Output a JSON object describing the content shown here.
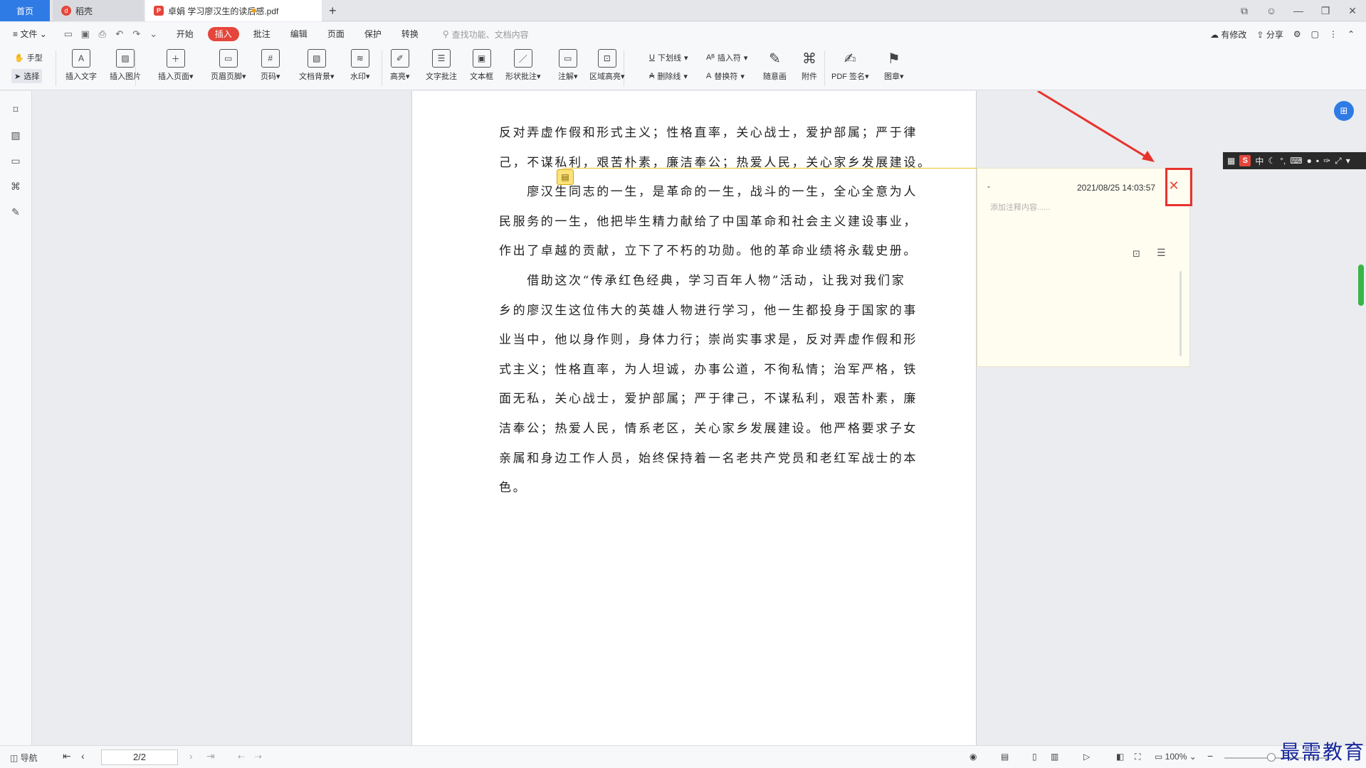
{
  "tabs": {
    "home": "首页",
    "daoke": "稻壳",
    "doc": "卓娟 学习廖汉生的读后感.pdf",
    "new": "+"
  },
  "menu": {
    "file": "文件",
    "items": [
      "开始",
      "插入",
      "批注",
      "编辑",
      "页面",
      "保护",
      "转换"
    ],
    "active_index": 1,
    "search_placeholder": "查找功能、文档内容",
    "modify": "有修改",
    "share": "分享"
  },
  "ribbon": {
    "hand": "手型",
    "select": "选择",
    "tools": [
      "插入文字",
      "插入图片",
      "插入页面",
      "页眉页脚",
      "页码",
      "文档背景",
      "水印",
      "高亮",
      "文字批注",
      "文本框",
      "形状批注",
      "注解",
      "区域高亮"
    ],
    "underline": "下划线",
    "strikethrough": "删除线",
    "insert_symbol": "插入符",
    "replace_symbol": "替换符",
    "freehand": "随意画",
    "attachment": "附件",
    "pdf_sign": "PDF 签名",
    "stamp": "图章"
  },
  "document": {
    "lines": [
      "反对弄虚作假和形式主义；性格直率，关心战士，爱护部属；严于律",
      "己，不谋私利，艰苦朴素，廉洁奉公；热爱人民，关心家乡发展建设。",
      "　　廖汉生同志的一生，是革命的一生，战斗的一生，全心全意为人",
      "民服务的一生，他把毕生精力献给了中国革命和社会主义建设事业，",
      "作出了卓越的贡献，立下了不朽的功勋。他的革命业绩将永载史册。",
      "　　借助这次“传承红色经典，学习百年人物”活动，让我对我们家",
      "乡的廖汉生这位伟大的英雄人物进行学习，他一生都投身于国家的事",
      "业当中，他以身作则，身体力行；崇尚实事求是，反对弄虚作假和形",
      "式主义；性格直率，为人坦诚，办事公道，不徇私情；治军严格，铁",
      "面无私，关心战士，爱护部属；严于律己，不谋私利，艰苦朴素，廉",
      "洁奉公；热爱人民，情系老区，关心家乡发展建设。他严格要求子女",
      "亲属和身边工作人员，始终保持着一名老共产党员和老红军战士的本",
      "色。"
    ]
  },
  "comment": {
    "author": "-",
    "timestamp": "2021/08/25 14:03:57",
    "placeholder": "添加注释内容......"
  },
  "status": {
    "nav": "导航",
    "page": "2/2",
    "zoom": "100%"
  },
  "watermark": "最需教育",
  "colors": {
    "accent": "#e5463b",
    "blue": "#2f7be6",
    "highlight_box": "#e8322d"
  }
}
